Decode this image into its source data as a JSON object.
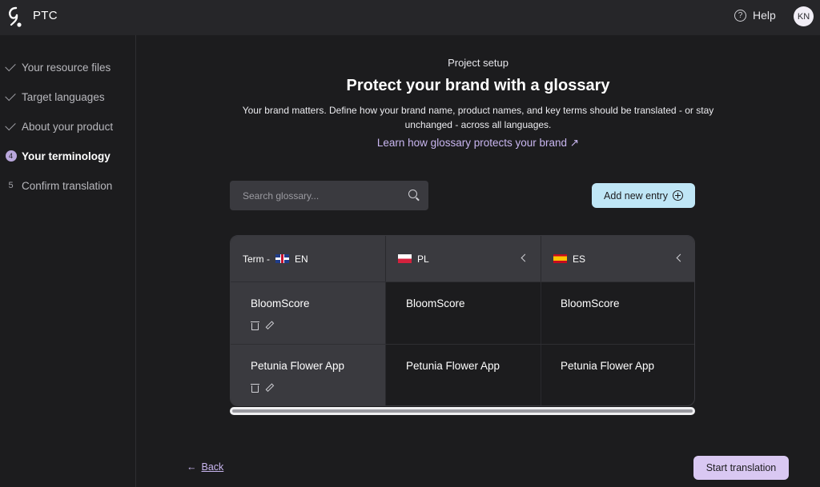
{
  "app": {
    "name": "PTC",
    "logo_icon": "ptc-logo-icon"
  },
  "header": {
    "help_label": "Help",
    "avatar_initials": "KN"
  },
  "steps": [
    {
      "label": "Your resource files",
      "state": "done"
    },
    {
      "label": "Target languages",
      "state": "done"
    },
    {
      "label": "About your product",
      "state": "done"
    },
    {
      "label": "Your terminology",
      "state": "active",
      "number": "4"
    },
    {
      "label": "Confirm translation",
      "state": "pending",
      "number": "5"
    }
  ],
  "main": {
    "kicker": "Project setup",
    "title": "Protect your brand with a glossary",
    "description": "Your brand matters. Define how your brand name, product names, and key terms should be translated - or stay unchanged - across all languages.",
    "learn_link": "Learn how glossary protects your brand ↗"
  },
  "search": {
    "placeholder": "Search glossary..."
  },
  "add_entry_label": "Add new entry",
  "table": {
    "term_header": "Term -",
    "columns": [
      {
        "code": "EN",
        "flag": "uk-flag"
      },
      {
        "code": "PL",
        "flag": "poland-flag"
      },
      {
        "code": "ES",
        "flag": "spain-flag"
      }
    ],
    "rows": [
      {
        "term": "BloomScore",
        "pl": "BloomScore",
        "es": "BloomScore"
      },
      {
        "term": "Petunia Flower App",
        "pl": "Petunia Flower App",
        "es": "Petunia Flower App"
      }
    ]
  },
  "footer": {
    "back_arrow": "←",
    "back_label": "Back",
    "start_label": "Start translation"
  },
  "colors": {
    "accent": "#c9b6f0",
    "add_button": "#bfe6f6",
    "start_button": "#d9c8f2",
    "background": "#1c1c1e"
  }
}
